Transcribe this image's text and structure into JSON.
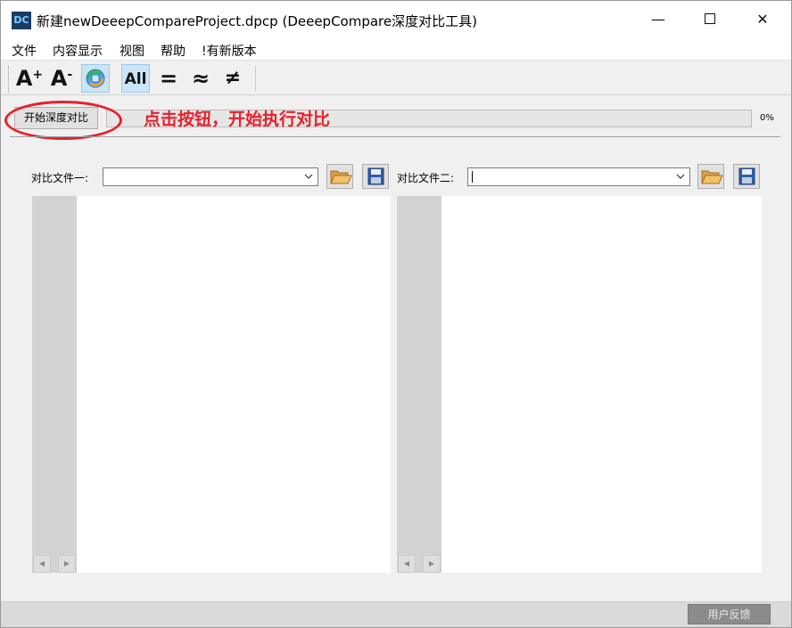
{
  "window": {
    "title": "新建newDeeepCompareProject.dpcp  (DeeepCompare深度对比工具)",
    "app_icon_text": "DC",
    "min_glyph": "—",
    "close_glyph": "✕"
  },
  "menu": {
    "items": [
      "文件",
      "内容显示",
      "视图",
      "帮助",
      "!有新版本"
    ]
  },
  "toolbar": {
    "font_increase_text": "A",
    "font_increase_sup": "+",
    "font_decrease_text": "A",
    "font_decrease_sup": "-",
    "all_label": "All",
    "equal_label": "=",
    "approx_label": "≈",
    "notequal_label": "≠"
  },
  "controls": {
    "start_button": "开始深度对比",
    "annotation": "点击按钮，开始执行对比",
    "progress_percent": 0,
    "progress_text": "0%"
  },
  "file1": {
    "label": "对比文件一:",
    "value": ""
  },
  "file2": {
    "label": "对比文件二:",
    "value": ""
  },
  "scroll": {
    "left_arrow": "◀",
    "right_arrow": "▶"
  },
  "status": {
    "feedback_button": "用户反馈"
  },
  "colors": {
    "annotation_red": "#e8202a",
    "gutter_gray": "#d3d3d3",
    "toolbar_active": "#cce4f7"
  }
}
